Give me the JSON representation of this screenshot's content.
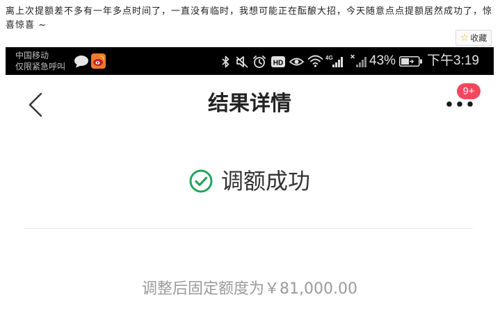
{
  "post": {
    "text": "离上次提额差不多有一年多点时间了，一直没有临时，我想可能正在酝酿大招，今天随意点点提额居然成功了，惊喜惊喜 ~",
    "favorite_label": "收藏",
    "favorite_icon": "star-icon"
  },
  "status_bar": {
    "carrier": "中国移动",
    "emergency_text": "仅限紧急呼叫",
    "notification_icons": [
      "message-bubble-icon",
      "weibo-icon"
    ],
    "system_icons": [
      "bluetooth-icon",
      "mute-icon",
      "alarm-icon",
      "hd-icon",
      "eye-icon",
      "wifi-icon",
      "signal-icon",
      "no-signal-icon",
      "battery-icon"
    ],
    "hd_label": "HD",
    "network_label": "4G",
    "battery_percent": "43%",
    "time": "下午3:19"
  },
  "app": {
    "header": {
      "title": "结果详情",
      "back_icon": "chevron-left-icon",
      "more_icon": "more-dots-icon",
      "badge": "9+"
    },
    "result": {
      "status": "调额成功",
      "status_icon": "check-circle-icon",
      "amount_text": "调整后固定额度为￥81,000.00"
    }
  },
  "colors": {
    "success": "#22a45a",
    "badge": "#f2475d",
    "star": "#f4b400",
    "status_bar_bg": "#000000",
    "amount_text": "#9a9a9a"
  }
}
